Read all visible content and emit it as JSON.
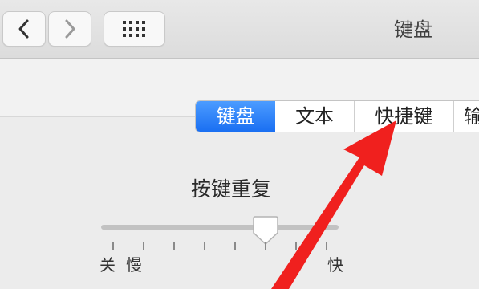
{
  "window": {
    "title": "键盘"
  },
  "toolbar": {
    "back_icon": "chevron-left-icon",
    "forward_icon": "chevron-right-icon",
    "grid_icon": "grid-icon"
  },
  "tabs": [
    {
      "label": "键盘",
      "selected": true
    },
    {
      "label": "文本",
      "selected": false
    },
    {
      "label": "快捷键",
      "selected": false
    },
    {
      "label": "输",
      "selected": false
    }
  ],
  "key_repeat": {
    "title": "按键重复",
    "off_label": "关",
    "slow_label": "慢",
    "fast_label": "快",
    "level": 0.73
  },
  "colors": {
    "accent": "#1a6ff2",
    "annotation_arrow": "#f0201e"
  }
}
